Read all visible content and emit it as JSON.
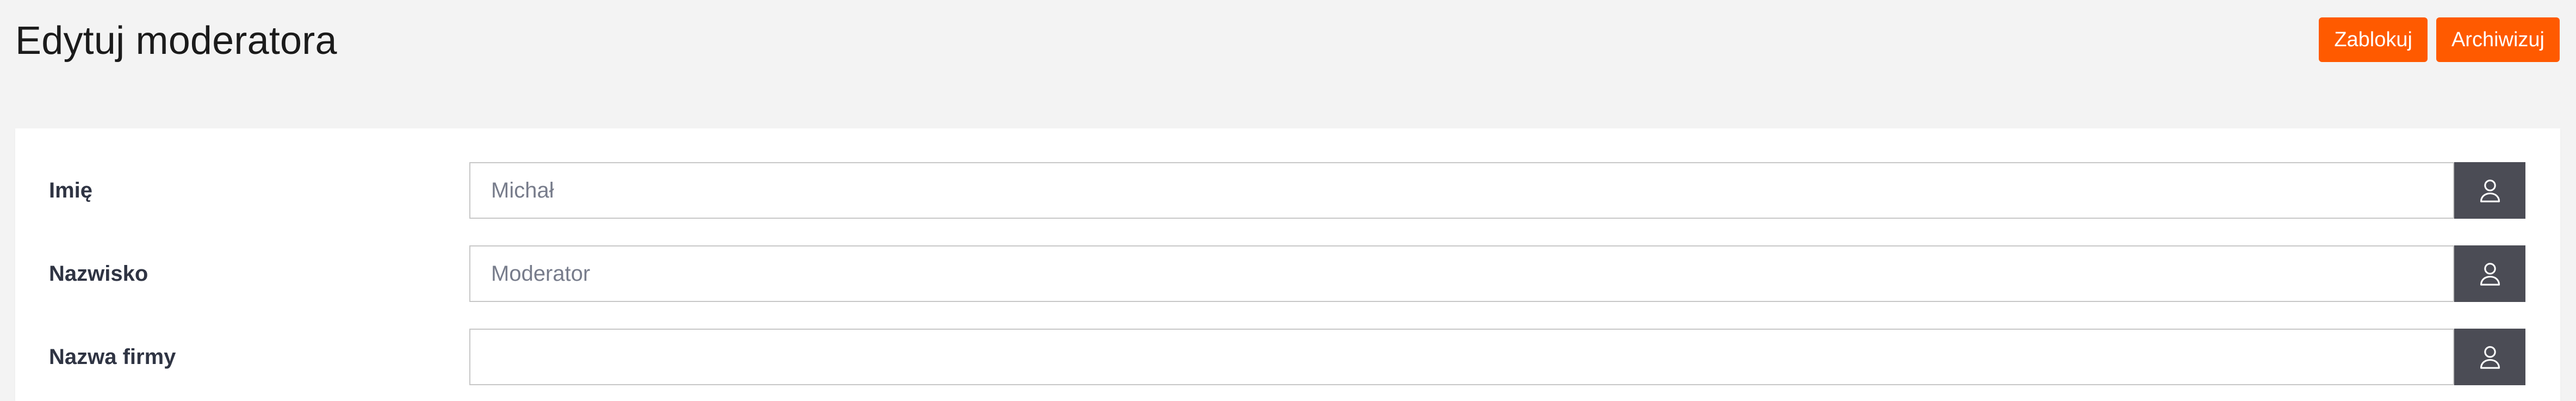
{
  "page": {
    "title": "Edytuj moderatora"
  },
  "actions": {
    "block_label": "Zablokuj",
    "archive_label": "Archiwizuj"
  },
  "form": {
    "fields": [
      {
        "label": "Imię",
        "value": "",
        "placeholder": "Michał",
        "icon": "user-icon"
      },
      {
        "label": "Nazwisko",
        "value": "",
        "placeholder": "Moderator",
        "icon": "user-icon"
      },
      {
        "label": "Nazwa firmy",
        "value": "",
        "placeholder": "",
        "icon": "user-icon"
      }
    ]
  },
  "colors": {
    "accent": "#ff5a00",
    "addon_background": "#4b4c55",
    "page_background": "#f3f3f3"
  }
}
